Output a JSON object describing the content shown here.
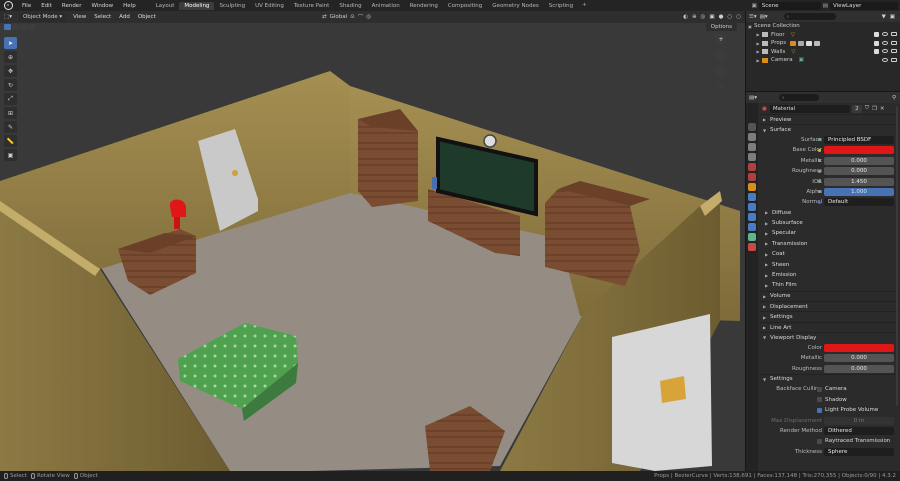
{
  "menu": [
    "File",
    "Edit",
    "Render",
    "Window",
    "Help"
  ],
  "workspaces": [
    "Layout",
    "Modeling",
    "Sculpting",
    "UV Editing",
    "Texture Paint",
    "Shading",
    "Animation",
    "Rendering",
    "Compositing",
    "Geometry Nodes",
    "Scripting"
  ],
  "active_workspace": "Modeling",
  "scene_name": "Scene",
  "view_layer": "ViewLayer",
  "viewport": {
    "mode": "Object Mode",
    "menus": [
      "View",
      "Select",
      "Add",
      "Object"
    ],
    "transform_orientation": "Global",
    "options": "Options"
  },
  "outliner": {
    "search_placeholder": "",
    "root": "Scene Collection",
    "items": [
      {
        "name": "Floor"
      },
      {
        "name": "Props"
      },
      {
        "name": "Walls"
      },
      {
        "name": "Camera"
      }
    ]
  },
  "properties": {
    "material_name": "Material",
    "material_users": "2",
    "panels": {
      "preview": "Preview",
      "surface": "Surface",
      "volume": "Volume",
      "displacement": "Displacement",
      "settings": "Settings",
      "line_art": "Line Art",
      "viewport_display": "Viewport Display",
      "settings_sub": "Settings"
    },
    "surface": {
      "surface_label": "Surface",
      "surface_value": "Principled BSDF",
      "base_color_label": "Base Color",
      "metallic_label": "Metallic",
      "metallic_value": "0.000",
      "roughness_label": "Roughness",
      "roughness_value": "0.000",
      "ior_label": "IOR",
      "ior_value": "1.450",
      "alpha_label": "Alpha",
      "alpha_value": "1.000",
      "normal_label": "Normal",
      "normal_value": "Default"
    },
    "subpanels": [
      "Diffuse",
      "Subsurface",
      "Specular",
      "Transmission",
      "Coat",
      "Sheen",
      "Emission",
      "Thin Film"
    ],
    "viewport_display": {
      "color_label": "Color",
      "metallic_label": "Metallic",
      "metallic_value": "0.000",
      "roughness_label": "Roughness",
      "roughness_value": "0.000"
    },
    "settings": {
      "backface_culling_label": "Backface Culling",
      "camera_label": "Camera",
      "shadow_label": "Shadow",
      "light_probe_label": "Light Probe Volume",
      "max_displacement_label": "Max Displacement",
      "max_displacement_value": "0 m",
      "render_method_label": "Render Method",
      "render_method_value": "Dithered",
      "raytraced_label": "Raytraced Transmission",
      "thickness_label": "Thickness",
      "thickness_value": "Sphere"
    }
  },
  "status": {
    "select": "Select",
    "rotate": "Rotate View",
    "object": "Object",
    "stats": "Props | BezierCurve | Verts:138,691 | Faces:137,148 | Tris:270,355 | Objects:0/90 | 4.3.2"
  },
  "colors": {
    "accent": "#4772b3",
    "base_color": "#e01717"
  }
}
